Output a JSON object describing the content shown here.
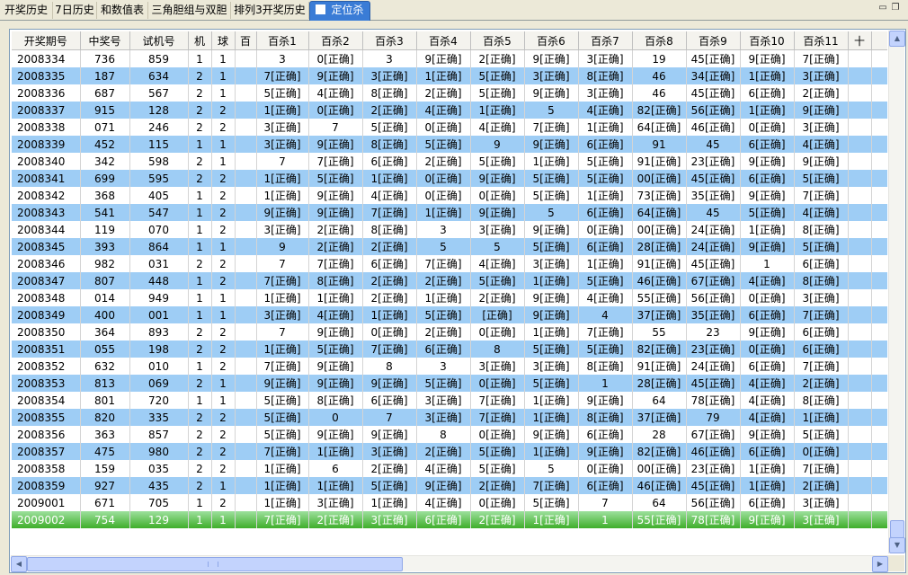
{
  "tabs": [
    {
      "label": "开奖历史"
    },
    {
      "label": "7日历史"
    },
    {
      "label": "和数值表"
    },
    {
      "label": "三角胆组与双胆"
    },
    {
      "label": "排列3开奖历史"
    },
    {
      "label": "定位杀"
    }
  ],
  "colors": {
    "accent": "#3a7cd6",
    "row_alt": "#9ecdf5",
    "row_current": "#3fae2a"
  },
  "table": {
    "headers": [
      "开奖期号",
      "中奖号",
      "试机号",
      "机",
      "球",
      "百",
      "百杀1",
      "百杀2",
      "百杀3",
      "百杀4",
      "百杀5",
      "百杀6",
      "百杀7",
      "百杀8",
      "百杀9",
      "百杀10",
      "百杀11",
      "十",
      ""
    ],
    "rows": [
      [
        "2008334",
        "736",
        "859",
        "1",
        "1",
        "",
        "3",
        "0[正确]",
        "3",
        "9[正确]",
        "2[正确]",
        "9[正确]",
        "3[正确]",
        "19",
        "45[正确]",
        "9[正确]",
        "7[正确]",
        "",
        ""
      ],
      [
        "2008335",
        "187",
        "634",
        "2",
        "1",
        "",
        "7[正确]",
        "9[正确]",
        "3[正确]",
        "1[正确]",
        "5[正确]",
        "3[正确]",
        "8[正确]",
        "46",
        "34[正确]",
        "1[正确]",
        "3[正确]",
        "",
        ""
      ],
      [
        "2008336",
        "687",
        "567",
        "2",
        "1",
        "",
        "5[正确]",
        "4[正确]",
        "8[正确]",
        "2[正确]",
        "5[正确]",
        "9[正确]",
        "3[正确]",
        "46",
        "45[正确]",
        "6[正确]",
        "2[正确]",
        "",
        ""
      ],
      [
        "2008337",
        "915",
        "128",
        "2",
        "2",
        "",
        "1[正确]",
        "0[正确]",
        "2[正确]",
        "4[正确]",
        "1[正确]",
        "5",
        "4[正确]",
        "82[正确]",
        "56[正确]",
        "1[正确]",
        "9[正确]",
        "",
        ""
      ],
      [
        "2008338",
        "071",
        "246",
        "2",
        "2",
        "",
        "3[正确]",
        "7",
        "5[正确]",
        "0[正确]",
        "4[正确]",
        "7[正确]",
        "1[正确]",
        "64[正确]",
        "46[正确]",
        "0[正确]",
        "3[正确]",
        "",
        ""
      ],
      [
        "2008339",
        "452",
        "115",
        "1",
        "1",
        "",
        "3[正确]",
        "9[正确]",
        "8[正确]",
        "5[正确]",
        "9",
        "9[正确]",
        "6[正确]",
        "91",
        "45",
        "6[正确]",
        "4[正确]",
        "",
        ""
      ],
      [
        "2008340",
        "342",
        "598",
        "2",
        "1",
        "",
        "7",
        "7[正确]",
        "6[正确]",
        "2[正确]",
        "5[正确]",
        "1[正确]",
        "5[正确]",
        "91[正确]",
        "23[正确]",
        "9[正确]",
        "9[正确]",
        "",
        ""
      ],
      [
        "2008341",
        "699",
        "595",
        "2",
        "2",
        "",
        "1[正确]",
        "5[正确]",
        "1[正确]",
        "0[正确]",
        "9[正确]",
        "5[正确]",
        "5[正确]",
        "00[正确]",
        "45[正确]",
        "6[正确]",
        "5[正确]",
        "",
        ""
      ],
      [
        "2008342",
        "368",
        "405",
        "1",
        "2",
        "",
        "1[正确]",
        "9[正确]",
        "4[正确]",
        "0[正确]",
        "0[正确]",
        "5[正确]",
        "1[正确]",
        "73[正确]",
        "35[正确]",
        "9[正确]",
        "7[正确]",
        "",
        ""
      ],
      [
        "2008343",
        "541",
        "547",
        "1",
        "2",
        "",
        "9[正确]",
        "9[正确]",
        "7[正确]",
        "1[正确]",
        "9[正确]",
        "5",
        "6[正确]",
        "64[正确]",
        "45",
        "5[正确]",
        "4[正确]",
        "",
        ""
      ],
      [
        "2008344",
        "119",
        "070",
        "1",
        "2",
        "",
        "3[正确]",
        "2[正确]",
        "8[正确]",
        "3",
        "3[正确]",
        "9[正确]",
        "0[正确]",
        "00[正确]",
        "24[正确]",
        "1[正确]",
        "8[正确]",
        "",
        ""
      ],
      [
        "2008345",
        "393",
        "864",
        "1",
        "1",
        "",
        "9",
        "2[正确]",
        "2[正确]",
        "5",
        "5",
        "5[正确]",
        "6[正确]",
        "28[正确]",
        "24[正确]",
        "9[正确]",
        "5[正确]",
        "",
        ""
      ],
      [
        "2008346",
        "982",
        "031",
        "2",
        "2",
        "",
        "7",
        "7[正确]",
        "6[正确]",
        "7[正确]",
        "4[正确]",
        "3[正确]",
        "1[正确]",
        "91[正确]",
        "45[正确]",
        "1",
        "6[正确]",
        "",
        ""
      ],
      [
        "2008347",
        "807",
        "448",
        "1",
        "2",
        "",
        "7[正确]",
        "8[正确]",
        "2[正确]",
        "2[正确]",
        "5[正确]",
        "1[正确]",
        "5[正确]",
        "46[正确]",
        "67[正确]",
        "4[正确]",
        "8[正确]",
        "",
        ""
      ],
      [
        "2008348",
        "014",
        "949",
        "1",
        "1",
        "",
        "1[正确]",
        "1[正确]",
        "2[正确]",
        "1[正确]",
        "2[正确]",
        "9[正确]",
        "4[正确]",
        "55[正确]",
        "56[正确]",
        "0[正确]",
        "3[正确]",
        "",
        ""
      ],
      [
        "2008349",
        "400",
        "001",
        "1",
        "1",
        "",
        "3[正确]",
        "4[正确]",
        "1[正确]",
        "5[正确]",
        "[正确]",
        "9[正确]",
        "4",
        "37[正确]",
        "35[正确]",
        "6[正确]",
        "7[正确]",
        "",
        ""
      ],
      [
        "2008350",
        "364",
        "893",
        "2",
        "2",
        "",
        "7",
        "9[正确]",
        "0[正确]",
        "2[正确]",
        "0[正确]",
        "1[正确]",
        "7[正确]",
        "55",
        "23",
        "9[正确]",
        "6[正确]",
        "",
        ""
      ],
      [
        "2008351",
        "055",
        "198",
        "2",
        "2",
        "",
        "1[正确]",
        "5[正确]",
        "7[正确]",
        "6[正确]",
        "8",
        "5[正确]",
        "5[正确]",
        "82[正确]",
        "23[正确]",
        "0[正确]",
        "6[正确]",
        "",
        ""
      ],
      [
        "2008352",
        "632",
        "010",
        "1",
        "2",
        "",
        "7[正确]",
        "9[正确]",
        "8",
        "3",
        "3[正确]",
        "3[正确]",
        "8[正确]",
        "91[正确]",
        "24[正确]",
        "6[正确]",
        "7[正确]",
        "",
        ""
      ],
      [
        "2008353",
        "813",
        "069",
        "2",
        "1",
        "",
        "9[正确]",
        "9[正确]",
        "9[正确]",
        "5[正确]",
        "0[正确]",
        "5[正确]",
        "1",
        "28[正确]",
        "45[正确]",
        "4[正确]",
        "2[正确]",
        "",
        ""
      ],
      [
        "2008354",
        "801",
        "720",
        "1",
        "1",
        "",
        "5[正确]",
        "8[正确]",
        "6[正确]",
        "3[正确]",
        "7[正确]",
        "1[正确]",
        "9[正确]",
        "64",
        "78[正确]",
        "4[正确]",
        "8[正确]",
        "",
        ""
      ],
      [
        "2008355",
        "820",
        "335",
        "2",
        "2",
        "",
        "5[正确]",
        "0",
        "7",
        "3[正确]",
        "7[正确]",
        "1[正确]",
        "8[正确]",
        "37[正确]",
        "79",
        "4[正确]",
        "1[正确]",
        "",
        ""
      ],
      [
        "2008356",
        "363",
        "857",
        "2",
        "2",
        "",
        "5[正确]",
        "9[正确]",
        "9[正确]",
        "8",
        "0[正确]",
        "9[正确]",
        "6[正确]",
        "28",
        "67[正确]",
        "9[正确]",
        "5[正确]",
        "",
        ""
      ],
      [
        "2008357",
        "475",
        "980",
        "2",
        "2",
        "",
        "7[正确]",
        "1[正确]",
        "3[正确]",
        "2[正确]",
        "5[正确]",
        "1[正确]",
        "9[正确]",
        "82[正确]",
        "46[正确]",
        "6[正确]",
        "0[正确]",
        "",
        ""
      ],
      [
        "2008358",
        "159",
        "035",
        "2",
        "2",
        "",
        "1[正确]",
        "6",
        "2[正确]",
        "4[正确]",
        "5[正确]",
        "5",
        "0[正确]",
        "00[正确]",
        "23[正确]",
        "1[正确]",
        "7[正确]",
        "",
        ""
      ],
      [
        "2008359",
        "927",
        "435",
        "2",
        "1",
        "",
        "1[正确]",
        "1[正确]",
        "5[正确]",
        "9[正确]",
        "2[正确]",
        "7[正确]",
        "6[正确]",
        "46[正确]",
        "45[正确]",
        "1[正确]",
        "2[正确]",
        "",
        ""
      ],
      [
        "2009001",
        "671",
        "705",
        "1",
        "2",
        "",
        "1[正确]",
        "3[正确]",
        "1[正确]",
        "4[正确]",
        "0[正确]",
        "5[正确]",
        "7",
        "64",
        "56[正确]",
        "6[正确]",
        "3[正确]",
        "",
        ""
      ],
      [
        "2009002",
        "754",
        "129",
        "1",
        "1",
        "",
        "7[正确]",
        "2[正确]",
        "3[正确]",
        "6[正确]",
        "2[正确]",
        "1[正确]",
        "1",
        "55[正确]",
        "78[正确]",
        "9[正确]",
        "3[正确]",
        "",
        ""
      ]
    ]
  }
}
